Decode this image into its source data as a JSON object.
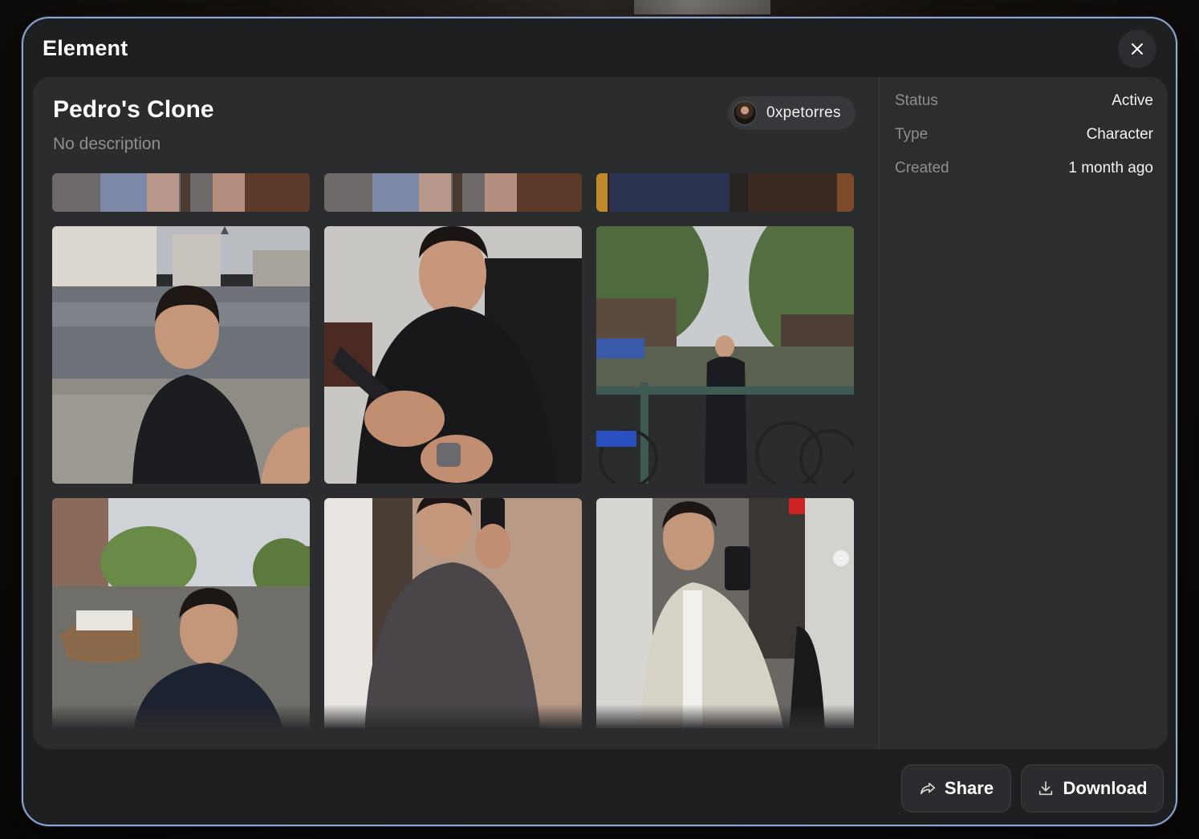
{
  "modal": {
    "title": "Element",
    "close_icon": "close-icon"
  },
  "element": {
    "name": "Pedro's Clone",
    "description": "No description",
    "owner": "0xpetorres"
  },
  "gallery": {
    "photos": [
      {
        "scene": "partial-top-1"
      },
      {
        "scene": "partial-top-2"
      },
      {
        "scene": "partial-top-3"
      },
      {
        "scene": "zurich-river-selfie"
      },
      {
        "scene": "tablet-drawing-selfie"
      },
      {
        "scene": "amsterdam-canal-bikes"
      },
      {
        "scene": "amsterdam-boat-selfie"
      },
      {
        "scene": "hoodie-mirror-selfie"
      },
      {
        "scene": "jacket-mirror-selfie"
      }
    ]
  },
  "details": {
    "status_label": "Status",
    "status_value": "Active",
    "type_label": "Type",
    "type_value": "Character",
    "created_label": "Created",
    "created_value": "1 month ago"
  },
  "actions": {
    "share_label": "Share",
    "share_icon": "share-icon",
    "download_label": "Download",
    "download_icon": "download-icon"
  },
  "colors": {
    "modal_bg": "#1e1f21",
    "panel_bg": "#2b2c2e",
    "border_accent": "#8da6d2",
    "muted_text": "#8e8f93"
  }
}
